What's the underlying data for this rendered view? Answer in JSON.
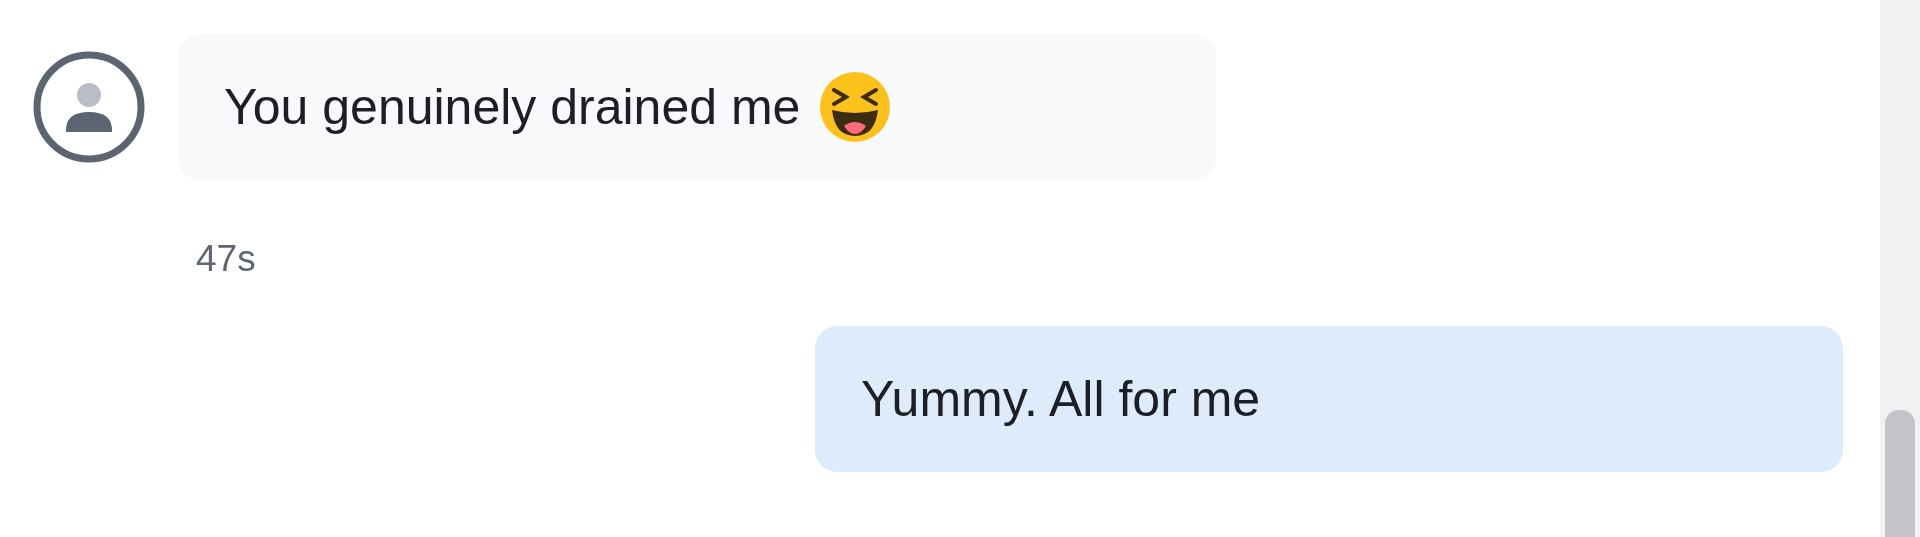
{
  "messages": [
    {
      "kind": "received",
      "text": "You genuinely drained me",
      "emoji": true,
      "time": "47s"
    },
    {
      "kind": "sent",
      "text": "Yummy. All for me",
      "emoji": false
    }
  ]
}
